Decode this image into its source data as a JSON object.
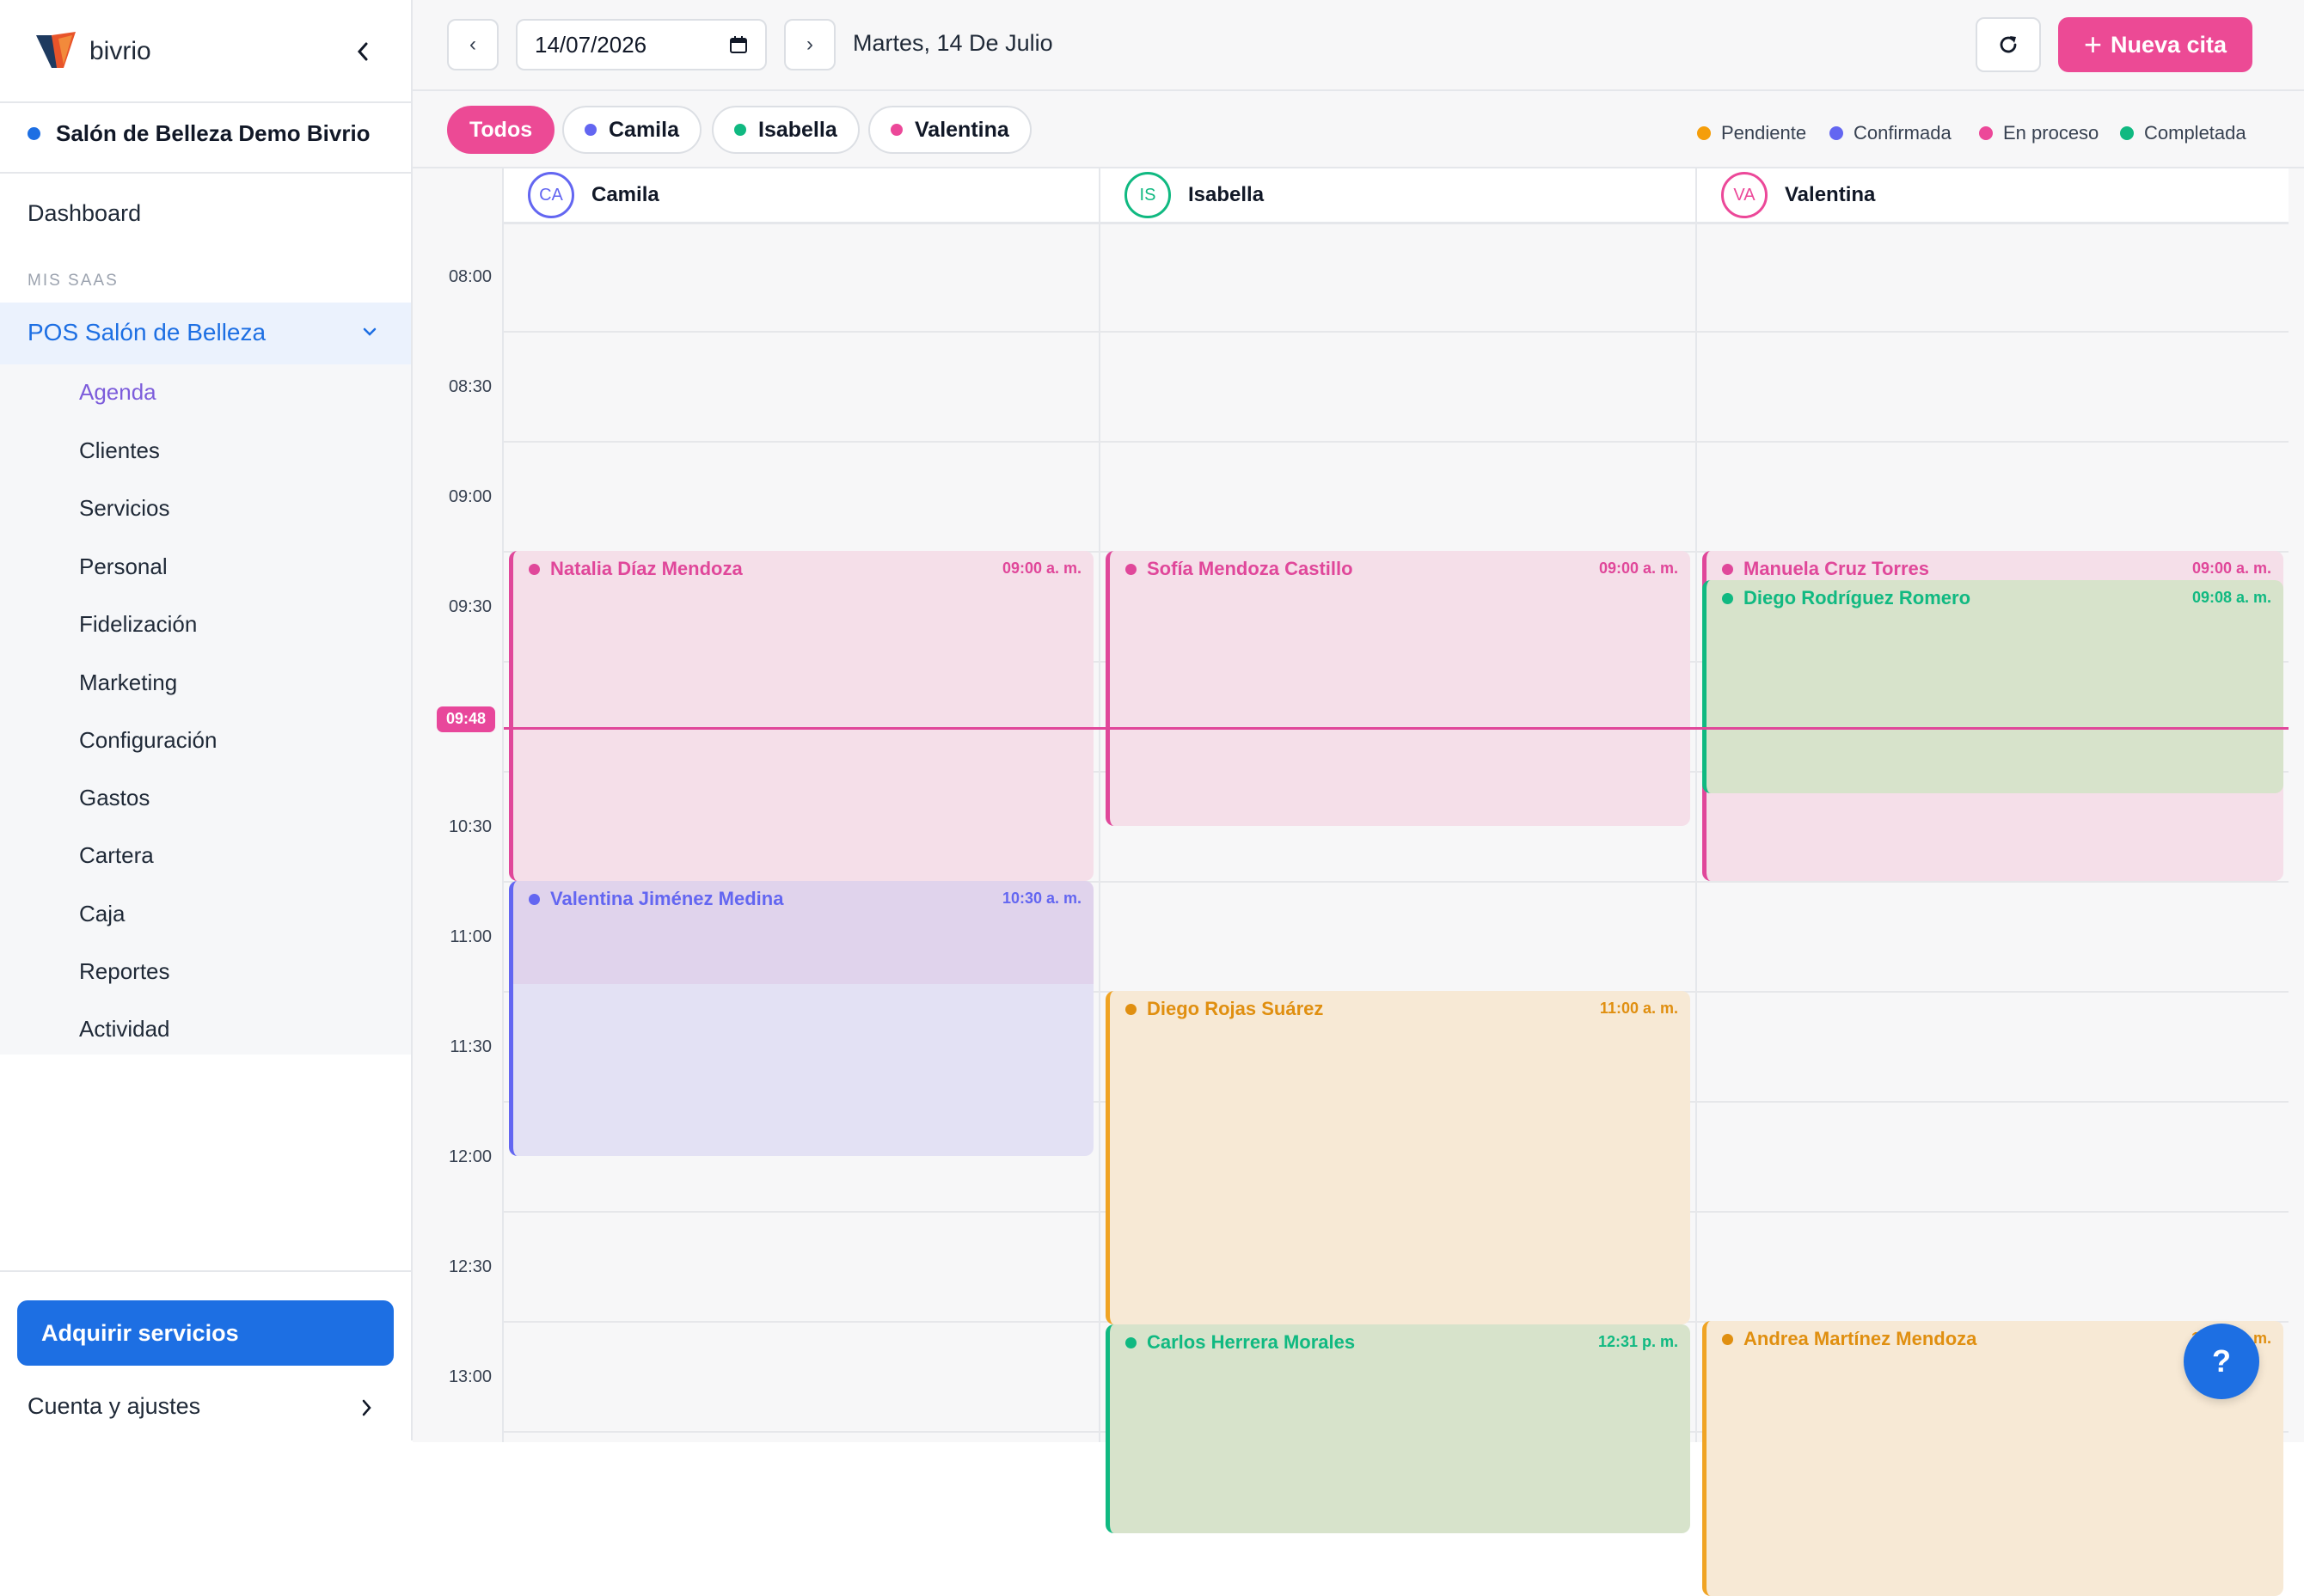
{
  "brand": {
    "name": "bivrio"
  },
  "sidebar": {
    "tenant": "Salón de Belleza Demo Bivrio",
    "dashboard": "Dashboard",
    "section_label": "MIS SAAS",
    "group": "POS Salón de Belleza",
    "items": [
      "Agenda",
      "Clientes",
      "Servicios",
      "Personal",
      "Fidelización",
      "Marketing",
      "Configuración",
      "Gastos",
      "Cartera",
      "Caja",
      "Reportes",
      "Actividad"
    ],
    "active_item": "Agenda",
    "cta": "Adquirir servicios",
    "account": "Cuenta y ajustes"
  },
  "toolbar": {
    "prev": "‹",
    "next": "›",
    "date_value": "14/07/2026",
    "date_label": "Martes, 14 De Julio",
    "new_button": "Nueva cita"
  },
  "filters": [
    {
      "label": "Todos",
      "active": true
    },
    {
      "label": "Camila",
      "color": "#6366f1"
    },
    {
      "label": "Isabella",
      "color": "#10b981"
    },
    {
      "label": "Valentina",
      "color": "#ec4899"
    }
  ],
  "legend": [
    {
      "label": "Pendiente",
      "color": "#f59e0b"
    },
    {
      "label": "Confirmada",
      "color": "#6366f1"
    },
    {
      "label": "En proceso",
      "color": "#ec4899"
    },
    {
      "label": "Completada",
      "color": "#10b981"
    }
  ],
  "calendar": {
    "times": [
      "08:00",
      "08:30",
      "09:00",
      "09:30",
      "10:00",
      "10:30",
      "11:00",
      "11:30",
      "12:00",
      "12:30",
      "13:00"
    ],
    "now": "09:48",
    "columns": [
      {
        "initials": "CA",
        "name": "Camila",
        "color": "#6366f1"
      },
      {
        "initials": "IS",
        "name": "Isabella",
        "color": "#10b981"
      },
      {
        "initials": "VA",
        "name": "Valentina",
        "color": "#ec4899"
      }
    ],
    "events": [
      {
        "col": 0,
        "name": "Natalia Díaz Mendoza",
        "time": "09:00 a. m.",
        "start": "09:00",
        "end": "10:30",
        "status": "En proceso"
      },
      {
        "col": 0,
        "name": "Valentina Jiménez Medina",
        "time": "10:30 a. m.",
        "start": "10:30",
        "end": "11:45",
        "status": "Confirmada"
      },
      {
        "col": 1,
        "name": "Sofía Mendoza Castillo",
        "time": "09:00 a. m.",
        "start": "09:00",
        "end": "10:15",
        "status": "En proceso"
      },
      {
        "col": 1,
        "name": "Diego Rojas Suárez",
        "time": "11:00 a. m.",
        "start": "11:00",
        "end": "12:31",
        "status": "Pendiente"
      },
      {
        "col": 1,
        "name": "Carlos Herrera Morales",
        "time": "12:31 p. m.",
        "start": "12:31",
        "end": "13:28",
        "status": "Completada"
      },
      {
        "col": 2,
        "name": "Manuela Cruz Torres",
        "time": "09:00 a. m.",
        "start": "09:00",
        "end": "10:30",
        "status": "En proceso"
      },
      {
        "col": 2,
        "name": "Diego Rodríguez Romero",
        "time": "09:08 a. m.",
        "start": "09:08",
        "end": "10:06",
        "status": "Completada"
      },
      {
        "col": 2,
        "name": "Andrea Martínez Mendoza",
        "time": "12:30 p. m.",
        "start": "12:30",
        "end": "13:45",
        "status": "Pendiente"
      }
    ]
  },
  "help": "?"
}
